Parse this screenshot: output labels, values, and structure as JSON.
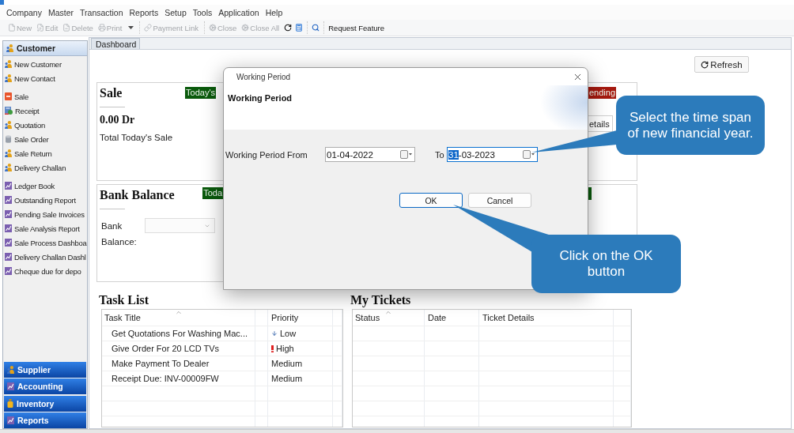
{
  "menu_bar": [
    "Company",
    "Master",
    "Transaction",
    "Reports",
    "Setup",
    "Tools",
    "Application",
    "Help"
  ],
  "toolbar": [
    {
      "kind": "button",
      "label": "New",
      "disabled": true
    },
    {
      "kind": "button",
      "label": "Edit",
      "disabled": true
    },
    {
      "kind": "button",
      "label": "Delete",
      "disabled": true
    },
    {
      "kind": "button",
      "label": "Print",
      "disabled": true
    },
    {
      "kind": "caret",
      "disabled": false
    },
    {
      "kind": "separator"
    },
    {
      "kind": "button",
      "label": "Payment Link",
      "disabled": true
    },
    {
      "kind": "separator"
    },
    {
      "kind": "button",
      "label": "Close",
      "disabled": true
    },
    {
      "kind": "button",
      "label": "Close All",
      "disabled": true
    },
    {
      "kind": "icon",
      "disabled": false
    },
    {
      "kind": "icon",
      "disabled": false
    },
    {
      "kind": "separator"
    },
    {
      "kind": "icon",
      "disabled": false
    },
    {
      "kind": "separator"
    },
    {
      "kind": "button",
      "label": "Request Feature",
      "disabled": false
    }
  ],
  "sidebar": {
    "sections": [
      {
        "label": "Customer",
        "kind": "person",
        "expanded": true,
        "groups": [
          {
            "items": [
              {
                "label": "New Customer",
                "kind": "person"
              },
              {
                "label": "New Contact",
                "kind": "person"
              }
            ]
          },
          {
            "items": [
              {
                "label": "Sale",
                "kind": "invoice"
              },
              {
                "label": "Receipt",
                "kind": "receipt"
              },
              {
                "label": "Quotation",
                "kind": "person"
              },
              {
                "label": "Sale Order",
                "kind": "order"
              },
              {
                "label": "Sale Return",
                "kind": "person"
              },
              {
                "label": "Delivery Challan",
                "kind": "person"
              }
            ]
          },
          {
            "items": [
              {
                "label": "Ledger Book",
                "kind": "report"
              },
              {
                "label": "Outstanding Report",
                "kind": "report"
              },
              {
                "label": "Pending Sale Invoices",
                "kind": "report"
              },
              {
                "label": "Sale Analysis Report",
                "kind": "report"
              },
              {
                "label": "Sale Process Dashboa",
                "kind": "report"
              },
              {
                "label": "Delivery Challan Dashl",
                "kind": "report"
              },
              {
                "label": "Cheque due for depo",
                "kind": "report"
              }
            ]
          }
        ]
      },
      {
        "label": "Supplier",
        "kind": "person",
        "expanded": false
      },
      {
        "label": "Accounting",
        "kind": "report",
        "expanded": false
      },
      {
        "label": "Inventory",
        "kind": "stock",
        "expanded": false
      },
      {
        "label": "Reports",
        "kind": "report",
        "expanded": false
      }
    ]
  },
  "tabs": [
    {
      "label": "Dashboard",
      "selected": true
    }
  ],
  "dashboard": {
    "refresh_button": "Refresh",
    "cards": [
      {
        "kind": "sale",
        "title": "Sale",
        "badges": [
          {
            "label": "Today's",
            "color": "#0a5a0c"
          },
          {
            "label": "ending",
            "color": "#a5190f"
          }
        ],
        "amount": "0.00 Dr",
        "caption": "Total Today's Sale",
        "tab": "etails"
      },
      {
        "kind": "bank",
        "title": "Bank Balance",
        "badges": [
          {
            "label": "Toda",
            "color": "#0a5a0c"
          },
          {
            "color": "#0a5a0c"
          }
        ],
        "bank_label": "Bank",
        "balance_label": "Balance:"
      }
    ]
  },
  "task_list": {
    "title": "Task List",
    "columns": [
      {
        "label": "Task Title",
        "sorted": true
      },
      {
        "label": "Priority",
        "sorted": false
      }
    ],
    "rows": [
      {
        "title": "Get Quotations For Washing Mac...",
        "priority": "Low",
        "kind": "low"
      },
      {
        "title": "Give Order For 20 LCD TVs",
        "priority": "High",
        "kind": "high"
      },
      {
        "title": "Make Payment To Dealer",
        "priority": "Medium",
        "kind": "normal"
      },
      {
        "title": "Receipt Due: INV-00009FW",
        "priority": "Medium",
        "kind": "normal"
      }
    ]
  },
  "my_tickets": {
    "title": "My Tickets",
    "columns": [
      {
        "label": "Status",
        "sorted": true
      },
      {
        "label": "Date",
        "sorted": false
      },
      {
        "label": "Ticket Details",
        "sorted": false
      }
    ]
  },
  "dialog": {
    "title": "Working Period",
    "heading": "Working Period",
    "fields": [
      {
        "label": "Working Period From",
        "value_parts": [
          {
            "text": "01-04-2022",
            "selected": false
          }
        ],
        "focused": false
      },
      {
        "label": "To",
        "value_parts": [
          {
            "text": "31",
            "selected": true
          },
          {
            "text": "-03-2023",
            "selected": false
          }
        ],
        "focused": true
      }
    ],
    "buttons": [
      {
        "label": "OK",
        "focused": true
      },
      {
        "label": "Cancel",
        "focused": false
      }
    ]
  },
  "callouts": [
    {
      "text": "Select the time span of new financial year."
    },
    {
      "text": "Click on the OK button"
    }
  ]
}
